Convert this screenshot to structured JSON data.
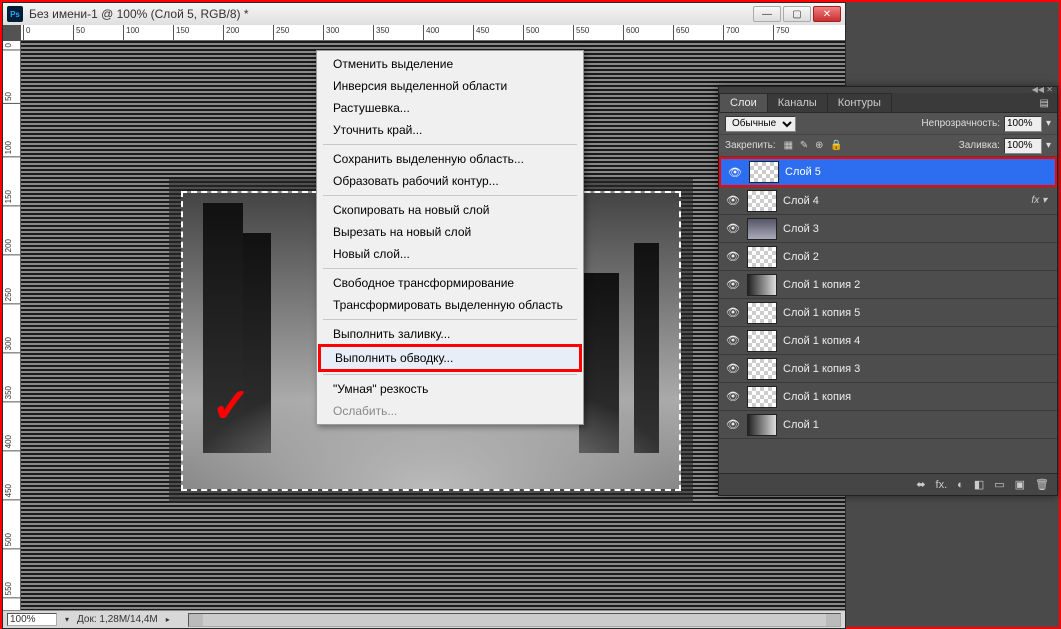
{
  "window": {
    "title": "Без имени-1 @ 100% (Слой 5, RGB/8) *",
    "ps_label": "Ps"
  },
  "ruler": {
    "h": [
      "0",
      "50",
      "100",
      "150",
      "200",
      "250",
      "300",
      "350",
      "400",
      "450",
      "500",
      "550",
      "600",
      "650",
      "700",
      "750"
    ],
    "v": [
      "0",
      "50",
      "100",
      "150",
      "200",
      "250",
      "300",
      "350",
      "400",
      "450",
      "500",
      "550"
    ]
  },
  "status": {
    "zoom": "100%",
    "doc_info": "Док: 1,28M/14,4M"
  },
  "context_menu": [
    {
      "label": "Отменить выделение",
      "kind": "item"
    },
    {
      "label": "Инверсия выделенной области",
      "kind": "item"
    },
    {
      "label": "Растушевка...",
      "kind": "item"
    },
    {
      "label": "Уточнить край...",
      "kind": "item"
    },
    {
      "kind": "sep"
    },
    {
      "label": "Сохранить выделенную область...",
      "kind": "item"
    },
    {
      "label": "Образовать рабочий контур...",
      "kind": "item"
    },
    {
      "kind": "sep"
    },
    {
      "label": "Скопировать на новый слой",
      "kind": "item"
    },
    {
      "label": "Вырезать на новый слой",
      "kind": "item"
    },
    {
      "label": "Новый слой...",
      "kind": "item"
    },
    {
      "kind": "sep"
    },
    {
      "label": "Свободное трансформирование",
      "kind": "item"
    },
    {
      "label": "Трансформировать выделенную область",
      "kind": "item"
    },
    {
      "kind": "sep"
    },
    {
      "label": "Выполнить заливку...",
      "kind": "item"
    },
    {
      "label": "Выполнить обводку...",
      "kind": "highlighted"
    },
    {
      "kind": "sep"
    },
    {
      "label": "\"Умная\" резкость",
      "kind": "item"
    },
    {
      "label": "Ослабить...",
      "kind": "disabled"
    }
  ],
  "layers_panel": {
    "tabs": [
      "Слои",
      "Каналы",
      "Контуры"
    ],
    "blend_mode": "Обычные",
    "opacity_label": "Непрозрачность:",
    "opacity_value": "100%",
    "lock_label": "Закрепить:",
    "fill_label": "Заливка:",
    "fill_value": "100%",
    "layers": [
      {
        "name": "Слой 5",
        "selected": true,
        "thumb": "trans",
        "fx": false
      },
      {
        "name": "Слой 4",
        "thumb": "trans",
        "fx": true
      },
      {
        "name": "Слой 3",
        "thumb": "photo"
      },
      {
        "name": "Слой 2",
        "thumb": "trans"
      },
      {
        "name": "Слой 1 копия 2",
        "thumb": "grad"
      },
      {
        "name": "Слой 1 копия 5",
        "thumb": "trans"
      },
      {
        "name": "Слой 1 копия 4",
        "thumb": "trans"
      },
      {
        "name": "Слой 1 копия 3",
        "thumb": "trans"
      },
      {
        "name": "Слой 1 копия",
        "thumb": "trans"
      },
      {
        "name": "Слой 1",
        "thumb": "grad"
      }
    ],
    "footer_icons": [
      "⬌",
      "fx.",
      "◐",
      "◧",
      "▭",
      "▣",
      "🗑"
    ]
  }
}
